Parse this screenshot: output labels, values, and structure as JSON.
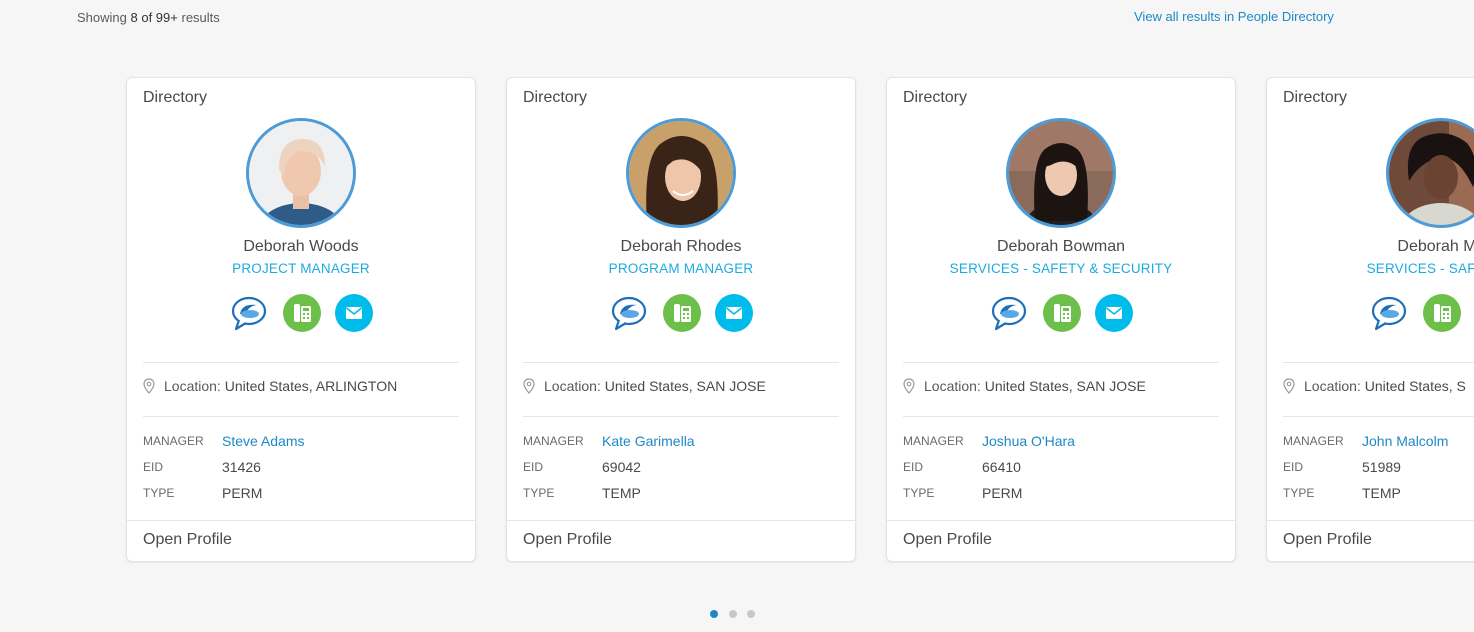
{
  "header": {
    "summary_prefix": "Showing",
    "summary_count": "8 of 99+",
    "summary_suffix": "results",
    "view_all": "View all results in People Directory"
  },
  "labels": {
    "location": "Location:",
    "manager": "MANAGER",
    "eid": "EID",
    "type": "TYPE",
    "open_profile": "Open Profile"
  },
  "colors": {
    "accent": "#1e88c7",
    "title": "#1eaadf",
    "phone": "#6cc04a",
    "mail": "#00bceb",
    "avatar_ring": "#4a9bd8"
  },
  "icons": [
    "chat-bubble-icon",
    "phone-icon",
    "mail-icon",
    "location-pin-icon"
  ],
  "cards": [
    {
      "source": "Directory",
      "name": "Deborah Woods",
      "title": "PROJECT MANAGER",
      "location": "United States, ARLINGTON",
      "manager": "Steve Adams",
      "eid": "31426",
      "type": "PERM"
    },
    {
      "source": "Directory",
      "name": "Deborah Rhodes",
      "title": "PROGRAM MANAGER",
      "location": "United States, SAN JOSE",
      "manager": "Kate Garimella",
      "eid": "69042",
      "type": "TEMP"
    },
    {
      "source": "Directory",
      "name": "Deborah Bowman",
      "title": "SERVICES - SAFETY & SECURITY",
      "location": "United States, SAN JOSE",
      "manager": "Joshua O'Hara",
      "eid": "66410",
      "type": "PERM"
    },
    {
      "source": "Directory",
      "name": "Deborah Mc",
      "title": "SERVICES - SAFETY &",
      "location": "United States, S",
      "manager": "John Malcolm",
      "eid": "51989",
      "type": "TEMP"
    }
  ],
  "pagination": {
    "pages": 3,
    "current": 1
  }
}
